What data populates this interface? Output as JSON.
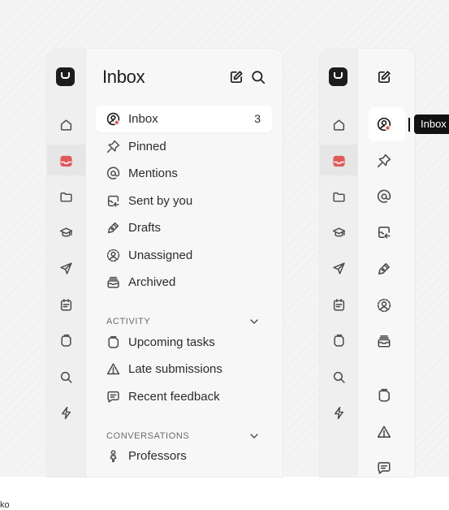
{
  "inbox_panel": {
    "title": "Inbox",
    "header_icons": [
      "compose-icon",
      "search-icon"
    ],
    "items": [
      {
        "label": "Inbox",
        "count": "3",
        "icon": "inbox-person-icon",
        "active": true
      },
      {
        "label": "Pinned",
        "icon": "pin-icon"
      },
      {
        "label": "Mentions",
        "icon": "at-icon"
      },
      {
        "label": "Sent by you",
        "icon": "sent-icon"
      },
      {
        "label": "Drafts",
        "icon": "pen-icon"
      },
      {
        "label": "Unassigned",
        "icon": "unassigned-icon"
      },
      {
        "label": "Archived",
        "icon": "archive-icon"
      }
    ],
    "activity": {
      "heading": "ACTIVITY",
      "items": [
        {
          "label": "Upcoming tasks",
          "icon": "tasks-icon"
        },
        {
          "label": "Late submissions",
          "icon": "warning-icon"
        },
        {
          "label": "Recent feedback",
          "icon": "feedback-icon"
        }
      ]
    },
    "conversations": {
      "heading": "CONVERSATIONS",
      "items": [
        {
          "label": "Professors",
          "icon": "professors-icon"
        }
      ]
    }
  },
  "rail_icons": [
    "home-icon",
    "inbox-tray-icon",
    "folder-icon",
    "graduation-cap-icon",
    "send-icon",
    "calendar-note-icon",
    "layers-icon",
    "search-icon",
    "bolt-icon"
  ],
  "collapsed_panel": {
    "tooltip": "Inbox"
  },
  "footer_text": "ko",
  "colors": {
    "accent": "#e05a5a",
    "dark": "#1c1c1e"
  }
}
